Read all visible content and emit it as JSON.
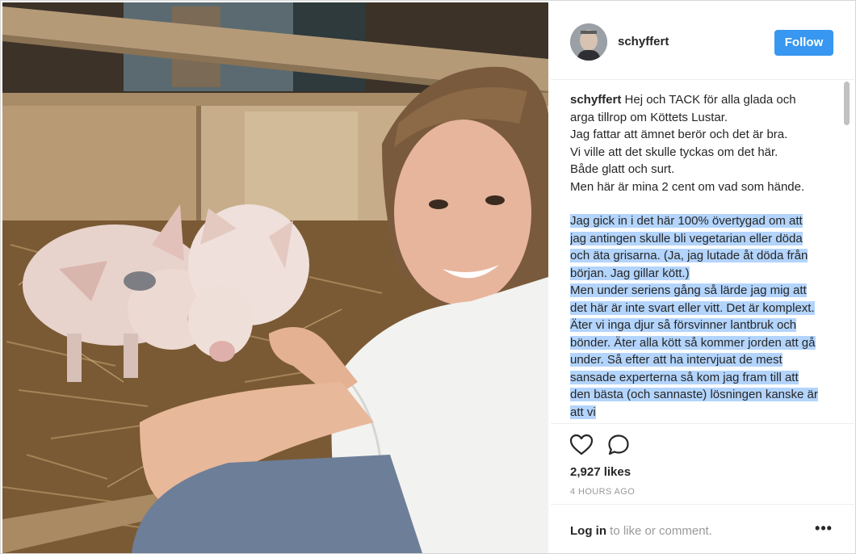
{
  "post": {
    "username": "schyffert",
    "follow_label": "Follow",
    "caption": {
      "username": "schyffert",
      "intro": " Hej och TACK för alla glada och arga tillrop om Köttets Lustar.\nJag fattar att ämnet berör och det är bra.\nVi ville att det skulle tyckas om det här.\nBåde glatt och surt.\nMen här är mina 2 cent om vad som hände.",
      "highlighted": "Jag gick in i det här 100% övertygad om att jag antingen skulle bli vegetarian eller döda och äta grisarna. (Ja, jag lutade åt döda från början. Jag gillar kött.)\nMen under seriens gång så lärde jag mig att det här är inte svart eller vitt. Det är komplext. Äter vi inga djur så försvinner lantbruk och bönder. Äter alla kött så kommer jorden att gå under. Så efter att ha intervjuat de mest sansade experterna så kom jag fram till att den bästa (och sannaste) lösningen kanske är att vi"
    },
    "likes": "2,927 likes",
    "time_ago": "4 HOURS AGO",
    "login_link": "Log in",
    "login_rest": " to like or comment.",
    "more_label": "•••",
    "icons": {
      "like": "heart-icon",
      "comment": "comment-icon",
      "scrollbar": "scrollbar"
    },
    "colors": {
      "follow_button": "#3897f0",
      "selection_highlight": "#b3d4fc",
      "muted_text": "#999999",
      "text": "#262626"
    }
  }
}
